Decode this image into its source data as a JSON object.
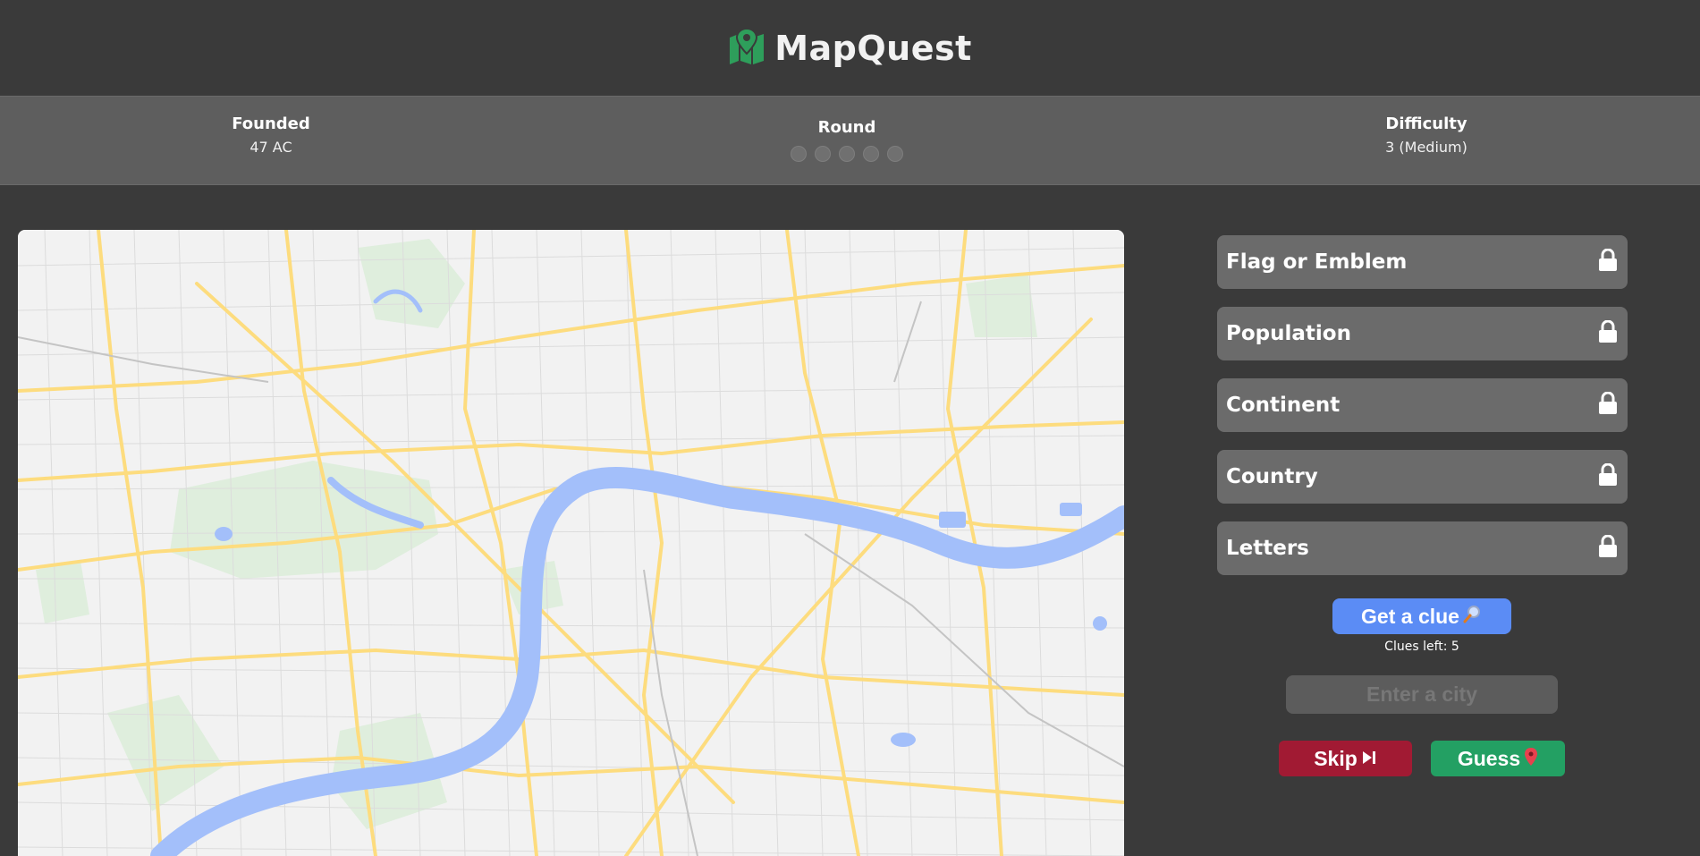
{
  "app": {
    "title": "MapQuest",
    "logo_icon": "map-marker-icon",
    "accent_color": "#2e9e5b"
  },
  "stats": {
    "founded": {
      "label": "Founded",
      "value": "47 AC"
    },
    "round": {
      "label": "Round",
      "total": 5,
      "completed": 0
    },
    "difficulty": {
      "label": "Difficulty",
      "value": "3 (Medium)"
    }
  },
  "map": {
    "river_color": "#a3bffa",
    "park_color": "#dfeedd",
    "road_color": "#fddc7e"
  },
  "clues": [
    {
      "label": "Flag or Emblem",
      "locked": true,
      "icon": "lock-icon"
    },
    {
      "label": "Population",
      "locked": true,
      "icon": "lock-icon"
    },
    {
      "label": "Continent",
      "locked": true,
      "icon": "lock-icon"
    },
    {
      "label": "Country",
      "locked": true,
      "icon": "lock-icon"
    },
    {
      "label": "Letters",
      "locked": true,
      "icon": "lock-icon"
    }
  ],
  "actions": {
    "get_clue_label": "Get a clue",
    "get_clue_icon": "magnifier-icon",
    "clues_left": "Clues left: 5",
    "city_placeholder": "Enter a city",
    "city_value": "",
    "skip_label": "Skip",
    "skip_icon": "skip-forward-icon",
    "guess_label": "Guess",
    "guess_icon": "map-pin-icon",
    "clue_btn_color": "#5b8cf5",
    "skip_btn_color": "#a11a33",
    "guess_btn_color": "#23a063"
  }
}
